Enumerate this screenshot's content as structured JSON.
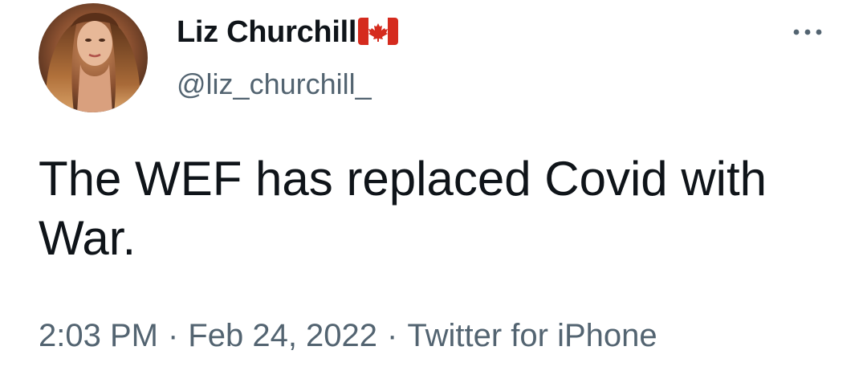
{
  "author": {
    "display_name": "Liz Churchill",
    "flag_icon": "canada-flag-icon",
    "handle": "@liz_churchill_"
  },
  "menu": {
    "icon": "more-options-icon"
  },
  "tweet": {
    "text": "The WEF has replaced Covid with War."
  },
  "meta": {
    "time": "2:03 PM",
    "separator": "·",
    "date": "Feb 24, 2022",
    "source": "Twitter for iPhone"
  },
  "colors": {
    "text_primary": "#0f1419",
    "text_secondary": "#536471",
    "flag_red": "#d52b1e",
    "background": "#ffffff"
  }
}
